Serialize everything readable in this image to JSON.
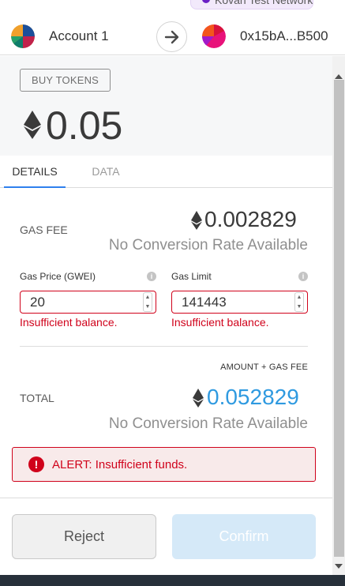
{
  "network": {
    "label": "Kovan Test Network",
    "color": "#6a1fc5"
  },
  "header": {
    "account_name": "Account 1",
    "recipient_address": "0x15bA...B500"
  },
  "amount": {
    "buy_tokens_label": "BUY TOKENS",
    "value": "0.05",
    "currency_icon": "ethereum-icon"
  },
  "tabs": [
    {
      "label": "DETAILS",
      "active": true
    },
    {
      "label": "DATA",
      "active": false
    }
  ],
  "details": {
    "gas_fee_label": "GAS FEE",
    "gas_fee_value": "0.002829",
    "gas_fee_fiat": "No Conversion Rate Available",
    "gas_price": {
      "label": "Gas Price (GWEI)",
      "value": "20",
      "error": "Insufficient balance."
    },
    "gas_limit": {
      "label": "Gas Limit",
      "value": "141443",
      "error": "Insufficient balance."
    },
    "amount_plus_gas_label": "AMOUNT + GAS FEE",
    "total_label": "TOTAL",
    "total_value": "0.052829",
    "total_fiat": "No Conversion Rate Available",
    "total_color": "#2f9ae0"
  },
  "alert": {
    "icon": "!",
    "text": "ALERT: Insufficient funds.",
    "color": "#d0021b"
  },
  "footer": {
    "reject_label": "Reject",
    "confirm_label": "Confirm"
  }
}
